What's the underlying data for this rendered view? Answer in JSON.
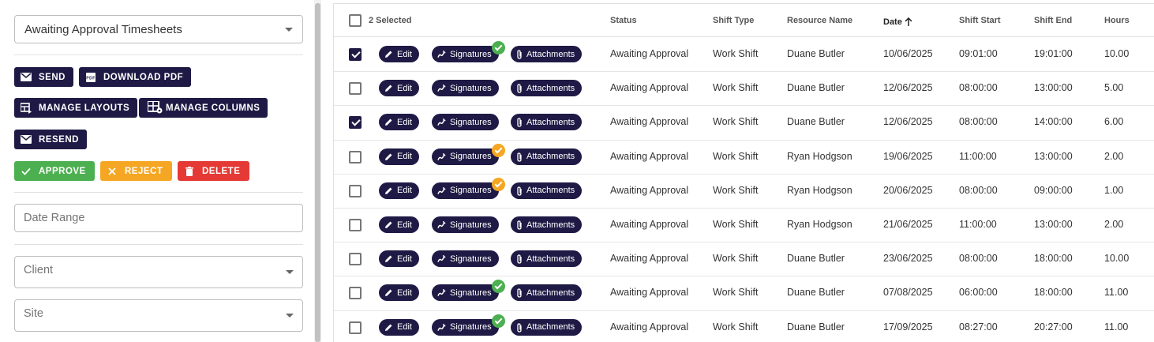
{
  "filters": {
    "view_select": "Awaiting Approval Timesheets",
    "date_range_placeholder": "Date Range",
    "client_placeholder": "Client",
    "site_placeholder": "Site"
  },
  "actions": {
    "send": "SEND",
    "download_pdf": "DOWNLOAD PDF",
    "manage_layouts": "MANAGE LAYOUTS",
    "manage_columns": "MANAGE COLUMNS",
    "resend": "RESEND",
    "approve": "APPROVE",
    "reject": "REJECT",
    "delete": "DELETE"
  },
  "colors": {
    "primary": "#1f1a45",
    "approve": "#4caf50",
    "reject": "#f5a623",
    "delete": "#e53935"
  },
  "grid": {
    "selected_label": "2 Selected",
    "columns": {
      "status": "Status",
      "shift_type": "Shift Type",
      "resource_name": "Resource Name",
      "date": "Date",
      "shift_start": "Shift Start",
      "shift_end": "Shift End",
      "hours": "Hours"
    },
    "row_actions": {
      "edit": "Edit",
      "signatures": "Signatures",
      "attachments": "Attachments"
    },
    "rows": [
      {
        "checked": true,
        "badge": "green",
        "status": "Awaiting Approval",
        "shift_type": "Work Shift",
        "resource": "Duane Butler",
        "date": "10/06/2025",
        "start": "09:01:00",
        "end": "19:01:00",
        "hours": "10.00"
      },
      {
        "checked": false,
        "badge": "",
        "status": "Awaiting Approval",
        "shift_type": "Work Shift",
        "resource": "Duane Butler",
        "date": "12/06/2025",
        "start": "08:00:00",
        "end": "13:00:00",
        "hours": "5.00"
      },
      {
        "checked": true,
        "badge": "",
        "status": "Awaiting Approval",
        "shift_type": "Work Shift",
        "resource": "Duane Butler",
        "date": "12/06/2025",
        "start": "08:00:00",
        "end": "14:00:00",
        "hours": "6.00"
      },
      {
        "checked": false,
        "badge": "orange",
        "status": "Awaiting Approval",
        "shift_type": "Work Shift",
        "resource": "Ryan Hodgson",
        "date": "19/06/2025",
        "start": "11:00:00",
        "end": "13:00:00",
        "hours": "2.00"
      },
      {
        "checked": false,
        "badge": "orange",
        "status": "Awaiting Approval",
        "shift_type": "Work Shift",
        "resource": "Ryan Hodgson",
        "date": "20/06/2025",
        "start": "08:00:00",
        "end": "09:00:00",
        "hours": "1.00"
      },
      {
        "checked": false,
        "badge": "",
        "status": "Awaiting Approval",
        "shift_type": "Work Shift",
        "resource": "Ryan Hodgson",
        "date": "21/06/2025",
        "start": "11:00:00",
        "end": "13:00:00",
        "hours": "2.00"
      },
      {
        "checked": false,
        "badge": "",
        "status": "Awaiting Approval",
        "shift_type": "Work Shift",
        "resource": "Duane Butler",
        "date": "23/06/2025",
        "start": "08:00:00",
        "end": "18:00:00",
        "hours": "10.00"
      },
      {
        "checked": false,
        "badge": "green",
        "status": "Awaiting Approval",
        "shift_type": "Work Shift",
        "resource": "Duane Butler",
        "date": "07/08/2025",
        "start": "06:00:00",
        "end": "18:00:00",
        "hours": "11.00"
      },
      {
        "checked": false,
        "badge": "green",
        "status": "Awaiting Approval",
        "shift_type": "Work Shift",
        "resource": "Duane Butler",
        "date": "17/09/2025",
        "start": "08:27:00",
        "end": "20:27:00",
        "hours": "11.00"
      }
    ]
  }
}
